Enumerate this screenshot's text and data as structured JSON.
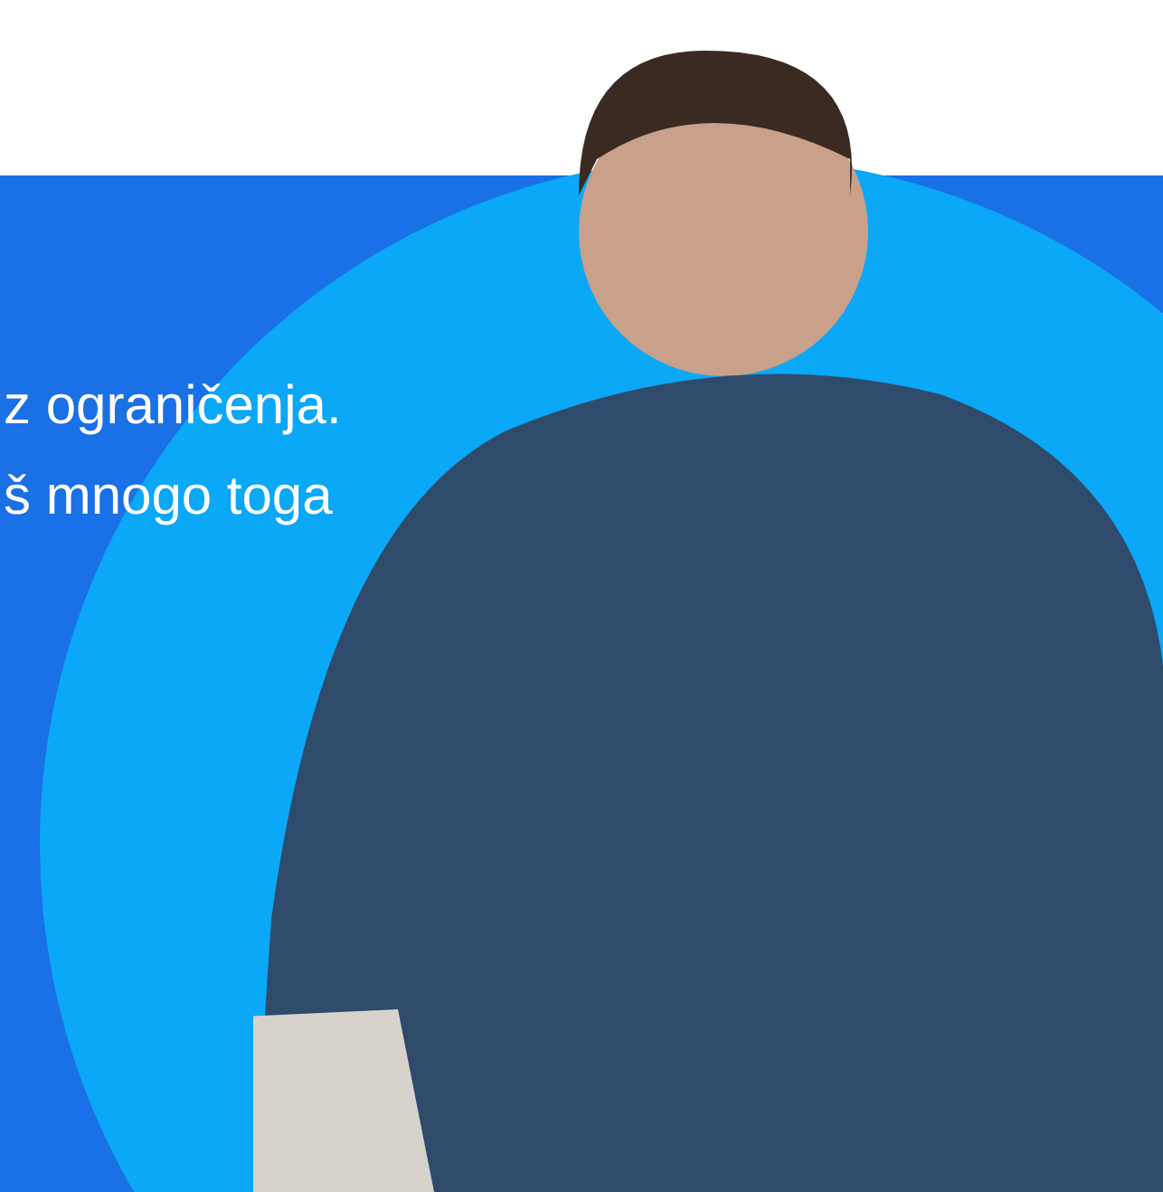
{
  "hero": {
    "lines": [
      "z ograničenja.",
      "š mnogo toga"
    ]
  }
}
